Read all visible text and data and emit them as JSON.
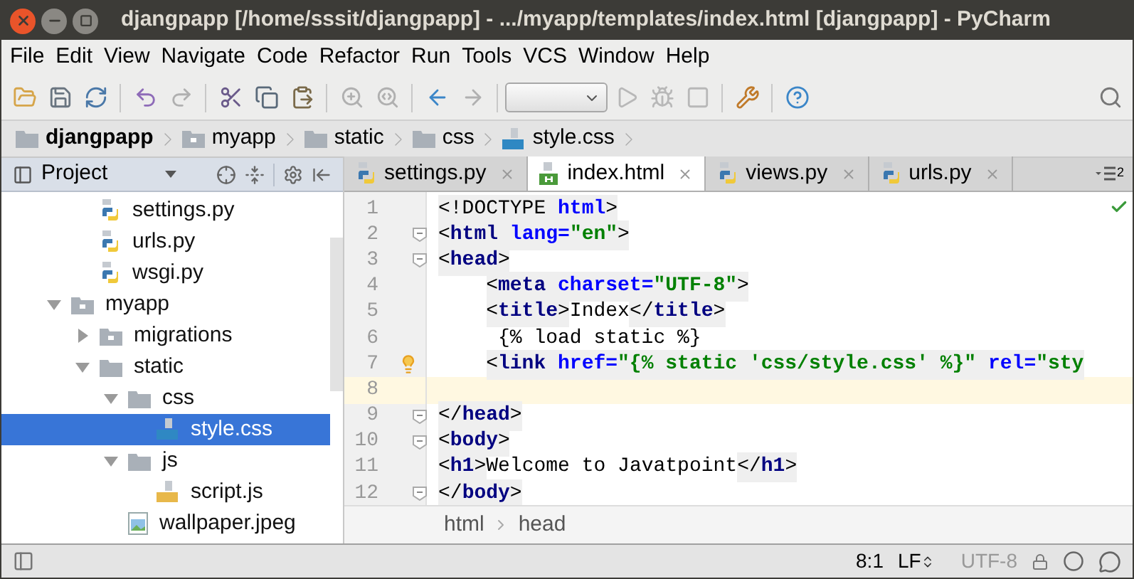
{
  "window": {
    "title": "djangpapp [/home/sssit/djangpapp] - .../myapp/templates/index.html [djangpapp] - PyCharm"
  },
  "menu": [
    "File",
    "Edit",
    "View",
    "Navigate",
    "Code",
    "Refactor",
    "Run",
    "Tools",
    "VCS",
    "Window",
    "Help"
  ],
  "navigation_bar": [
    {
      "label": "djangpapp",
      "kind": "folder",
      "bold": true
    },
    {
      "label": "myapp",
      "kind": "module",
      "bold": false
    },
    {
      "label": "static",
      "kind": "folder",
      "bold": false
    },
    {
      "label": "css",
      "kind": "folder",
      "bold": false
    },
    {
      "label": "style.css",
      "kind": "css",
      "bold": false
    }
  ],
  "project_panel": {
    "title": "Project",
    "tree": {
      "files_above": [
        {
          "label": "settings.py",
          "kind": "python",
          "selected": false
        },
        {
          "label": "urls.py",
          "kind": "python",
          "selected": false
        },
        {
          "label": "wsgi.py",
          "kind": "python",
          "selected": false
        }
      ],
      "nodes": [
        {
          "label": "myapp",
          "kind": "module",
          "expanded": true,
          "selected": false,
          "children": [
            {
              "label": "migrations",
              "kind": "module",
              "expanded": false,
              "selected": false
            },
            {
              "label": "static",
              "kind": "folder",
              "expanded": true,
              "selected": false,
              "children": [
                {
                  "label": "css",
                  "kind": "folder",
                  "expanded": true,
                  "selected": false,
                  "children": [
                    {
                      "label": "style.css",
                      "kind": "css",
                      "selected": true
                    }
                  ]
                },
                {
                  "label": "js",
                  "kind": "folder",
                  "expanded": true,
                  "selected": false,
                  "children": [
                    {
                      "label": "script.js",
                      "kind": "js",
                      "selected": false
                    }
                  ]
                },
                {
                  "label": "wallpaper.jpeg",
                  "kind": "image",
                  "selected": false
                }
              ]
            }
          ]
        }
      ]
    }
  },
  "editor_tabs": [
    {
      "label": "settings.py",
      "kind": "python",
      "selected": false
    },
    {
      "label": "index.html",
      "kind": "html",
      "selected": true
    },
    {
      "label": "views.py",
      "kind": "python",
      "selected": false
    },
    {
      "label": "urls.py",
      "kind": "python",
      "selected": false
    }
  ],
  "hidden_tabs_count": "2",
  "code_lines": [
    {
      "number": "1",
      "indented": false,
      "fold": false,
      "current": false,
      "bulb": false,
      "tokens": [
        {
          "kind": "punct",
          "text": "<!DOCTYPE "
        },
        {
          "kind": "attr",
          "text": "html"
        },
        {
          "kind": "punct",
          "text": ">"
        }
      ]
    },
    {
      "number": "2",
      "indented": false,
      "fold": true,
      "current": false,
      "bulb": false,
      "tokens": [
        {
          "kind": "punct",
          "text": "<"
        },
        {
          "kind": "tag",
          "text": "html "
        },
        {
          "kind": "attr",
          "text": "lang="
        },
        {
          "kind": "value",
          "text": "\"en\""
        },
        {
          "kind": "punct",
          "text": ">"
        }
      ]
    },
    {
      "number": "3",
      "indented": false,
      "fold": true,
      "current": false,
      "bulb": false,
      "tokens": [
        {
          "kind": "punct",
          "text": "<"
        },
        {
          "kind": "tag",
          "text": "head"
        },
        {
          "kind": "punct",
          "text": ">"
        }
      ]
    },
    {
      "number": "4",
      "indented": true,
      "fold": false,
      "current": false,
      "bulb": false,
      "tokens": [
        {
          "kind": "punct",
          "text": "<"
        },
        {
          "kind": "tag",
          "text": "meta "
        },
        {
          "kind": "attr",
          "text": "charset="
        },
        {
          "kind": "value",
          "text": "\"UTF-8\""
        },
        {
          "kind": "punct",
          "text": ">"
        }
      ]
    },
    {
      "number": "5",
      "indented": true,
      "fold": false,
      "current": false,
      "bulb": false,
      "tokens": [
        {
          "kind": "punct",
          "text": "<"
        },
        {
          "kind": "tag",
          "text": "title"
        },
        {
          "kind": "punct",
          "text": ">"
        },
        {
          "kind": "text",
          "text": "Index"
        },
        {
          "kind": "punct",
          "text": "</"
        },
        {
          "kind": "tag",
          "text": "title"
        },
        {
          "kind": "punct",
          "text": ">"
        }
      ]
    },
    {
      "number": "6",
      "indented": true,
      "fold": false,
      "current": false,
      "bulb": false,
      "tokens": [
        {
          "kind": "template",
          "text": "{% load static %}"
        }
      ]
    },
    {
      "number": "7",
      "indented": true,
      "fold": false,
      "current": false,
      "bulb": true,
      "tokens": [
        {
          "kind": "punct",
          "text": "<"
        },
        {
          "kind": "tag",
          "text": "link "
        },
        {
          "kind": "attr",
          "text": "href="
        },
        {
          "kind": "value",
          "text": "\"{% static 'css/style.css' %}\" "
        },
        {
          "kind": "attr",
          "text": "rel="
        },
        {
          "kind": "value",
          "text": "\"sty"
        }
      ]
    },
    {
      "number": "8",
      "indented": false,
      "fold": false,
      "current": true,
      "bulb": false
    },
    {
      "number": "9",
      "indented": false,
      "fold": true,
      "current": false,
      "bulb": false,
      "tokens": [
        {
          "kind": "punct",
          "text": "</"
        },
        {
          "kind": "tag",
          "text": "head"
        },
        {
          "kind": "punct",
          "text": ">"
        }
      ]
    },
    {
      "number": "10",
      "indented": false,
      "fold": true,
      "current": false,
      "bulb": false,
      "tokens": [
        {
          "kind": "punct",
          "text": "<"
        },
        {
          "kind": "tag",
          "text": "body"
        },
        {
          "kind": "punct",
          "text": ">"
        }
      ]
    },
    {
      "number": "11",
      "indented": false,
      "fold": false,
      "current": false,
      "bulb": false,
      "tokens": [
        {
          "kind": "punct",
          "text": "<"
        },
        {
          "kind": "tag",
          "text": "h1"
        },
        {
          "kind": "punct",
          "text": ">"
        },
        {
          "kind": "text",
          "text": "Welcome to Javatpoint"
        },
        {
          "kind": "punct",
          "text": "</"
        },
        {
          "kind": "tag",
          "text": "h1"
        },
        {
          "kind": "punct",
          "text": ">"
        }
      ]
    },
    {
      "number": "12",
      "indented": false,
      "fold": true,
      "current": false,
      "bulb": false,
      "tokens": [
        {
          "kind": "punct",
          "text": "</"
        },
        {
          "kind": "tag",
          "text": "body"
        },
        {
          "kind": "punct",
          "text": ">"
        }
      ]
    }
  ],
  "editor_breadcrumb": [
    "html",
    "head"
  ],
  "status_bar": {
    "position": "8:1",
    "line_separator": "LF",
    "encoding": "UTF-8"
  }
}
